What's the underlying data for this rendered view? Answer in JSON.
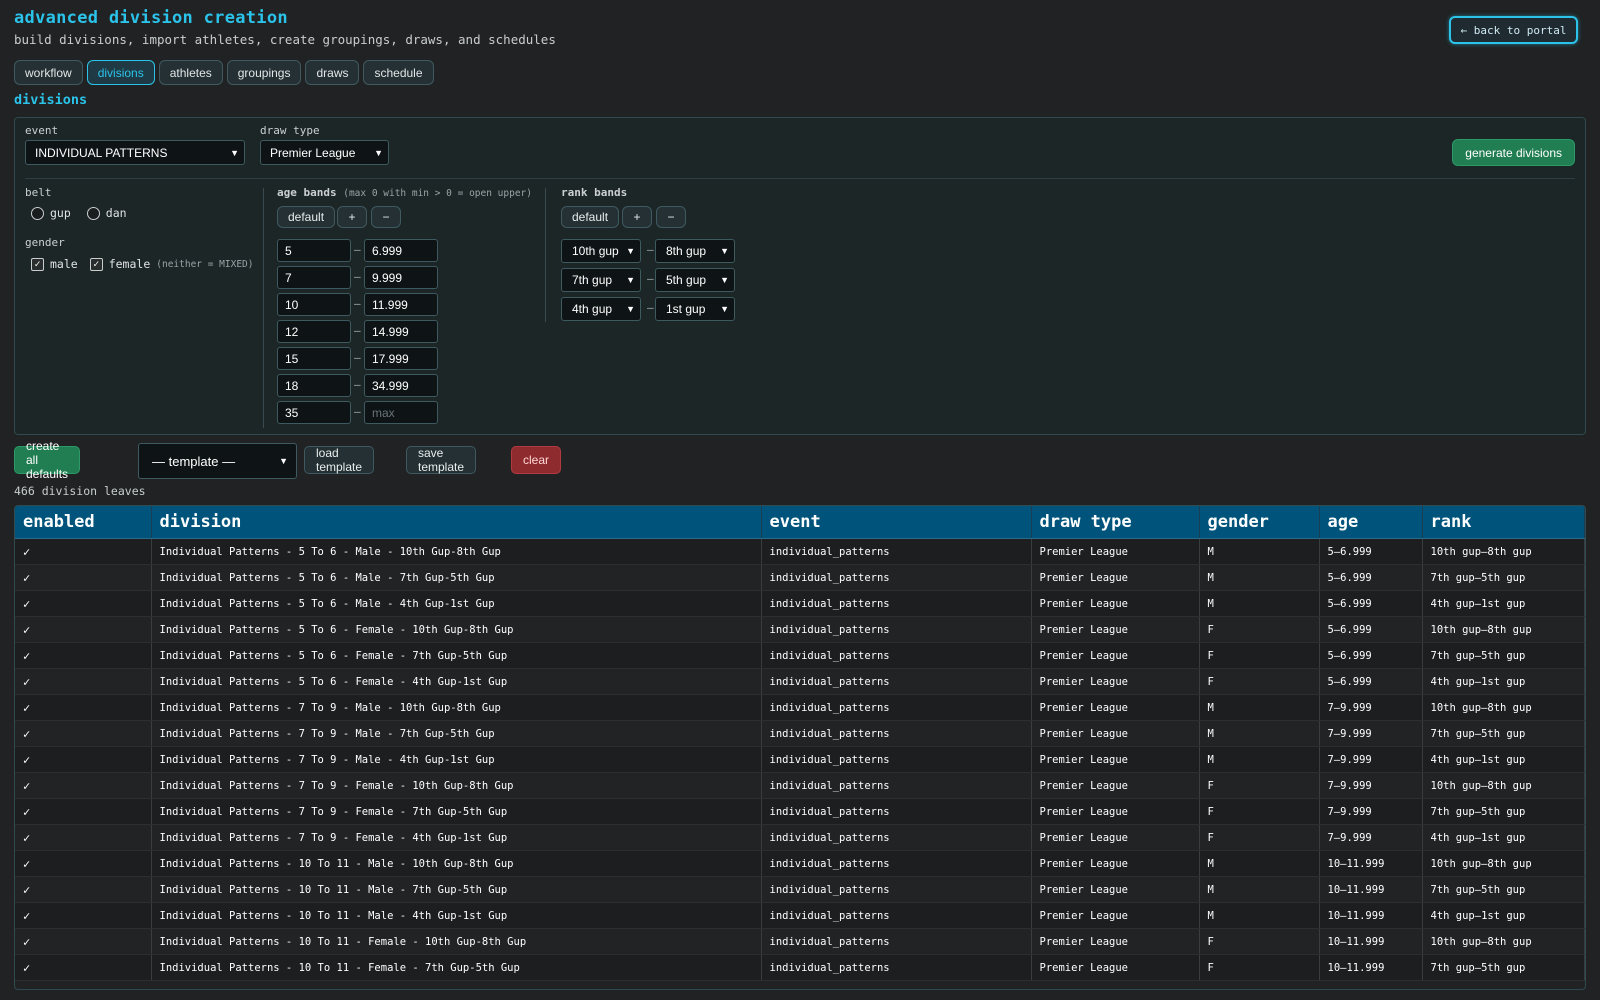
{
  "header": {
    "title": "advanced division creation",
    "subtitle": "build divisions, import athletes, create groupings, draws, and schedules",
    "back_label": "← back to portal"
  },
  "tabs": [
    {
      "label": "workflow",
      "active": false
    },
    {
      "label": "divisions",
      "active": true
    },
    {
      "label": "athletes",
      "active": false
    },
    {
      "label": "groupings",
      "active": false
    },
    {
      "label": "draws",
      "active": false
    },
    {
      "label": "schedule",
      "active": false
    }
  ],
  "section_title": "divisions",
  "form": {
    "event_label": "event",
    "event_value": "INDIVIDUAL PATTERNS",
    "draw_type_label": "draw type",
    "draw_type_value": "Premier League",
    "generate_label": "generate divisions",
    "belt_label": "belt",
    "belt_options": [
      {
        "label": "gup",
        "checked": false
      },
      {
        "label": "dan",
        "checked": false
      }
    ],
    "gender_label": "gender",
    "gender_options": [
      {
        "label": "male",
        "checked": true
      },
      {
        "label": "female",
        "checked": true
      }
    ],
    "gender_hint": "(neither = MIXED)",
    "age_bands_label": "age bands",
    "age_bands_hint": "(max 0 with min > 0 = open upper)",
    "rank_bands_label": "rank bands",
    "default_label": "default",
    "plus_label": "+",
    "minus_label": "−",
    "dash": "–",
    "age_bands": [
      {
        "min": "5",
        "max": "6.999"
      },
      {
        "min": "7",
        "max": "9.999"
      },
      {
        "min": "10",
        "max": "11.999"
      },
      {
        "min": "12",
        "max": "14.999"
      },
      {
        "min": "15",
        "max": "17.999"
      },
      {
        "min": "18",
        "max": "34.999"
      },
      {
        "min": "35",
        "max": "",
        "max_placeholder": "max"
      }
    ],
    "rank_bands": [
      {
        "from": "10th gup",
        "to": "8th gup"
      },
      {
        "from": "7th gup",
        "to": "5th gup"
      },
      {
        "from": "4th gup",
        "to": "1st gup"
      }
    ]
  },
  "actions": {
    "create_defaults": "create all defaults",
    "template_placeholder": "— template —",
    "load_template": "load template",
    "save_template": "save template",
    "clear": "clear"
  },
  "count_text": "466 division leaves",
  "table": {
    "columns": [
      "enabled",
      "division",
      "event",
      "draw type",
      "gender",
      "age",
      "rank"
    ],
    "rows": [
      [
        "✓",
        "Individual Patterns - 5 To 6 - Male - 10th Gup-8th Gup",
        "individual_patterns",
        "Premier League",
        "M",
        "5–6.999",
        "10th gup–8th gup"
      ],
      [
        "✓",
        "Individual Patterns - 5 To 6 - Male - 7th Gup-5th Gup",
        "individual_patterns",
        "Premier League",
        "M",
        "5–6.999",
        "7th gup–5th gup"
      ],
      [
        "✓",
        "Individual Patterns - 5 To 6 - Male - 4th Gup-1st Gup",
        "individual_patterns",
        "Premier League",
        "M",
        "5–6.999",
        "4th gup–1st gup"
      ],
      [
        "✓",
        "Individual Patterns - 5 To 6 - Female - 10th Gup-8th Gup",
        "individual_patterns",
        "Premier League",
        "F",
        "5–6.999",
        "10th gup–8th gup"
      ],
      [
        "✓",
        "Individual Patterns - 5 To 6 - Female - 7th Gup-5th Gup",
        "individual_patterns",
        "Premier League",
        "F",
        "5–6.999",
        "7th gup–5th gup"
      ],
      [
        "✓",
        "Individual Patterns - 5 To 6 - Female - 4th Gup-1st Gup",
        "individual_patterns",
        "Premier League",
        "F",
        "5–6.999",
        "4th gup–1st gup"
      ],
      [
        "✓",
        "Individual Patterns - 7 To 9 - Male - 10th Gup-8th Gup",
        "individual_patterns",
        "Premier League",
        "M",
        "7–9.999",
        "10th gup–8th gup"
      ],
      [
        "✓",
        "Individual Patterns - 7 To 9 - Male - 7th Gup-5th Gup",
        "individual_patterns",
        "Premier League",
        "M",
        "7–9.999",
        "7th gup–5th gup"
      ],
      [
        "✓",
        "Individual Patterns - 7 To 9 - Male - 4th Gup-1st Gup",
        "individual_patterns",
        "Premier League",
        "M",
        "7–9.999",
        "4th gup–1st gup"
      ],
      [
        "✓",
        "Individual Patterns - 7 To 9 - Female - 10th Gup-8th Gup",
        "individual_patterns",
        "Premier League",
        "F",
        "7–9.999",
        "10th gup–8th gup"
      ],
      [
        "✓",
        "Individual Patterns - 7 To 9 - Female - 7th Gup-5th Gup",
        "individual_patterns",
        "Premier League",
        "F",
        "7–9.999",
        "7th gup–5th gup"
      ],
      [
        "✓",
        "Individual Patterns - 7 To 9 - Female - 4th Gup-1st Gup",
        "individual_patterns",
        "Premier League",
        "F",
        "7–9.999",
        "4th gup–1st gup"
      ],
      [
        "✓",
        "Individual Patterns - 10 To 11 - Male - 10th Gup-8th Gup",
        "individual_patterns",
        "Premier League",
        "M",
        "10–11.999",
        "10th gup–8th gup"
      ],
      [
        "✓",
        "Individual Patterns - 10 To 11 - Male - 7th Gup-5th Gup",
        "individual_patterns",
        "Premier League",
        "M",
        "10–11.999",
        "7th gup–5th gup"
      ],
      [
        "✓",
        "Individual Patterns - 10 To 11 - Male - 4th Gup-1st Gup",
        "individual_patterns",
        "Premier League",
        "M",
        "10–11.999",
        "4th gup–1st gup"
      ],
      [
        "✓",
        "Individual Patterns - 10 To 11 - Female - 10th Gup-8th Gup",
        "individual_patterns",
        "Premier League",
        "F",
        "10–11.999",
        "10th gup–8th gup"
      ],
      [
        "✓",
        "Individual Patterns - 10 To 11 - Female - 7th Gup-5th Gup",
        "individual_patterns",
        "Premier League",
        "F",
        "10–11.999",
        "7th gup–5th gup"
      ]
    ]
  },
  "colors": {
    "accent": "#2bc3ea",
    "background": "#202223",
    "table_header": "#00547c",
    "success_button": "#217e52",
    "danger_button": "#8e2b2f"
  }
}
